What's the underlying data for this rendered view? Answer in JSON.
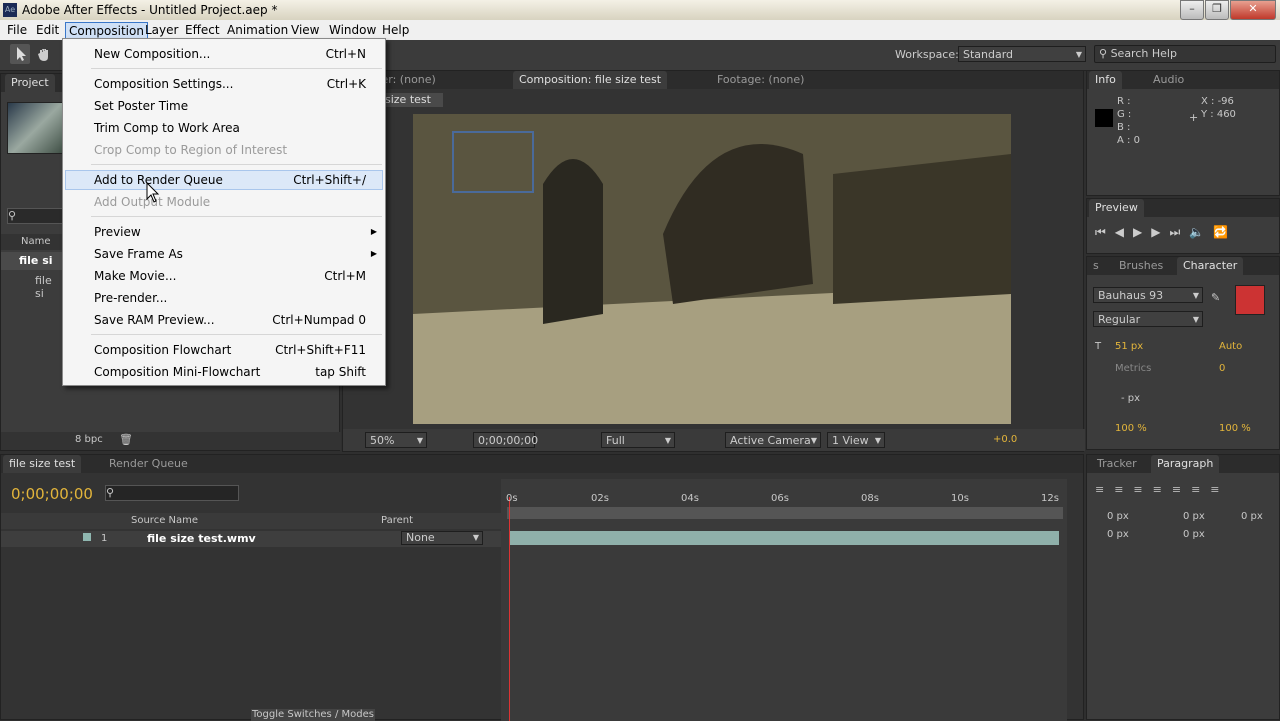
{
  "window": {
    "title": "Adobe After Effects - Untitled Project.aep *",
    "app_icon": "Ae"
  },
  "menubar": [
    "File",
    "Edit",
    "Composition",
    "Layer",
    "Effect",
    "Animation",
    "View",
    "Window",
    "Help"
  ],
  "toolbar": {
    "workspace_label": "Workspace:",
    "workspace_value": "Standard",
    "search_placeholder": "Search Help"
  },
  "composition_menu": {
    "items": [
      {
        "label": "New Composition...",
        "shortcut": "Ctrl+N",
        "enabled": true
      },
      {
        "label": "Composition Settings...",
        "shortcut": "Ctrl+K",
        "enabled": true
      },
      {
        "label": "Set Poster Time",
        "shortcut": "",
        "enabled": true
      },
      {
        "label": "Trim Comp to Work Area",
        "shortcut": "",
        "enabled": true
      },
      {
        "label": "Crop Comp to Region of Interest",
        "shortcut": "",
        "enabled": false
      },
      {
        "label": "Add to Render Queue",
        "shortcut": "Ctrl+Shift+/",
        "enabled": true,
        "highlighted": true
      },
      {
        "label": "Add Output Module",
        "shortcut": "",
        "enabled": false
      },
      {
        "label": "Preview",
        "shortcut": "",
        "enabled": true,
        "submenu": true
      },
      {
        "label": "Save Frame As",
        "shortcut": "",
        "enabled": true,
        "submenu": true
      },
      {
        "label": "Make Movie...",
        "shortcut": "Ctrl+M",
        "enabled": true
      },
      {
        "label": "Pre-render...",
        "shortcut": "",
        "enabled": true
      },
      {
        "label": "Save RAM Preview...",
        "shortcut": "Ctrl+Numpad 0",
        "enabled": true
      },
      {
        "label": "Composition Flowchart",
        "shortcut": "Ctrl+Shift+F11",
        "enabled": true
      },
      {
        "label": "Composition Mini-Flowchart",
        "shortcut": "tap Shift",
        "enabled": true
      }
    ]
  },
  "project": {
    "tab": "Project",
    "column_name": "Name",
    "items": [
      "file si",
      "file si"
    ],
    "bpc": "8 bpc"
  },
  "viewer": {
    "tabs": [
      "yer: (none)",
      "Composition: file size test",
      "Footage: (none)"
    ],
    "comp_tab": "size test",
    "zoom": "50%",
    "timecode": "0;00;00;00",
    "resolution": "Full",
    "camera": "Active Camera",
    "views": "1 View",
    "exposure": "+0.0"
  },
  "info": {
    "tabs": [
      "Info",
      "Audio"
    ],
    "r": "R :",
    "g": "G :",
    "b": "B :",
    "a": "A : 0",
    "x": "X : -96",
    "y": "Y : 460"
  },
  "preview": {
    "tab": "Preview"
  },
  "character": {
    "tabs": [
      "s",
      "Brushes",
      "Character"
    ],
    "font": "Bauhaus 93",
    "style": "Regular",
    "size": "51 px",
    "leading": "Auto",
    "kerning": "Metrics",
    "tracking": "0",
    "stroke": "- px",
    "vscale": "100 %",
    "hscale": "100 %"
  },
  "timeline": {
    "tabs": [
      "file size test",
      "Render Queue"
    ],
    "timecode": "0;00;00;00",
    "columns": {
      "source": "Source Name",
      "parent": "Parent"
    },
    "ruler": [
      "0s",
      "02s",
      "04s",
      "06s",
      "08s",
      "10s",
      "12s"
    ],
    "layer": {
      "num": "1",
      "name": "file size test.wmv",
      "parent": "None"
    },
    "footer": "Toggle Switches / Modes"
  },
  "tracker_paragraph": {
    "tabs": [
      "Tracker",
      "Paragraph"
    ],
    "px_values": [
      "0 px",
      "0 px",
      "0 px",
      "0 px",
      "0 px"
    ]
  }
}
